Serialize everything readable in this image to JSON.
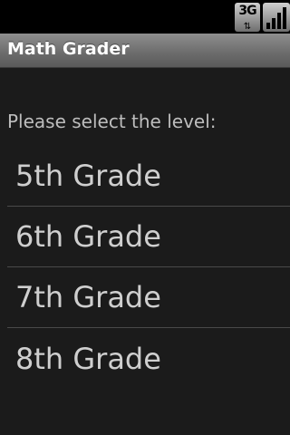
{
  "status_bar": {
    "network_type": "3G",
    "network_arrows": "⇅",
    "icons": [
      "3g-data-icon",
      "signal-strength-icon"
    ],
    "signal_level": 4
  },
  "app": {
    "title": "Math Grader"
  },
  "prompt": "Please select the level:",
  "levels": [
    {
      "label": "5th Grade"
    },
    {
      "label": "6th Grade"
    },
    {
      "label": "7th Grade"
    },
    {
      "label": "8th Grade"
    }
  ],
  "colors": {
    "background": "#1b1b1b",
    "status_bar": "#000000",
    "title_bar": "#6b6b6b",
    "text_primary": "#cfcfcf",
    "divider": "#4a4a4a"
  }
}
